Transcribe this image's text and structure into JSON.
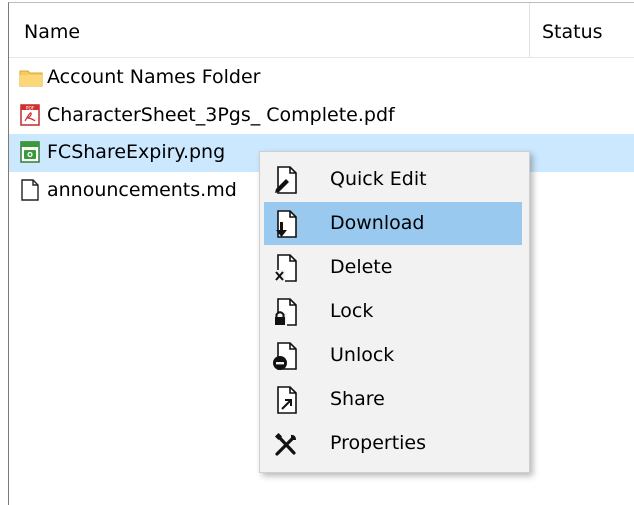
{
  "header": {
    "name_label": "Name",
    "status_label": "Status"
  },
  "files": [
    {
      "name": "Account Names Folder",
      "icon": "folder-icon",
      "selected": false
    },
    {
      "name": "CharacterSheet_3Pgs_ Complete.pdf",
      "icon": "pdf-file-icon",
      "selected": false
    },
    {
      "name": "FCShareExpiry.png",
      "icon": "image-file-icon",
      "selected": true
    },
    {
      "name": "announcements.md",
      "icon": "document-file-icon",
      "selected": false
    }
  ],
  "context_menu": {
    "items": [
      {
        "label": "Quick Edit",
        "icon": "edit-icon",
        "hovered": false
      },
      {
        "label": "Download",
        "icon": "download-icon",
        "hovered": true
      },
      {
        "label": "Delete",
        "icon": "delete-icon",
        "hovered": false
      },
      {
        "label": "Lock",
        "icon": "lock-icon",
        "hovered": false
      },
      {
        "label": "Unlock",
        "icon": "unlock-icon",
        "hovered": false
      },
      {
        "label": "Share",
        "icon": "share-icon",
        "hovered": false
      },
      {
        "label": "Properties",
        "icon": "properties-icon",
        "hovered": false
      }
    ]
  },
  "colors": {
    "selection": "#cce8ff",
    "menu_hover": "#99c9ef",
    "folder": "#f8c95c",
    "pdf": "#d32f2f",
    "image": "#3a9a3a"
  }
}
